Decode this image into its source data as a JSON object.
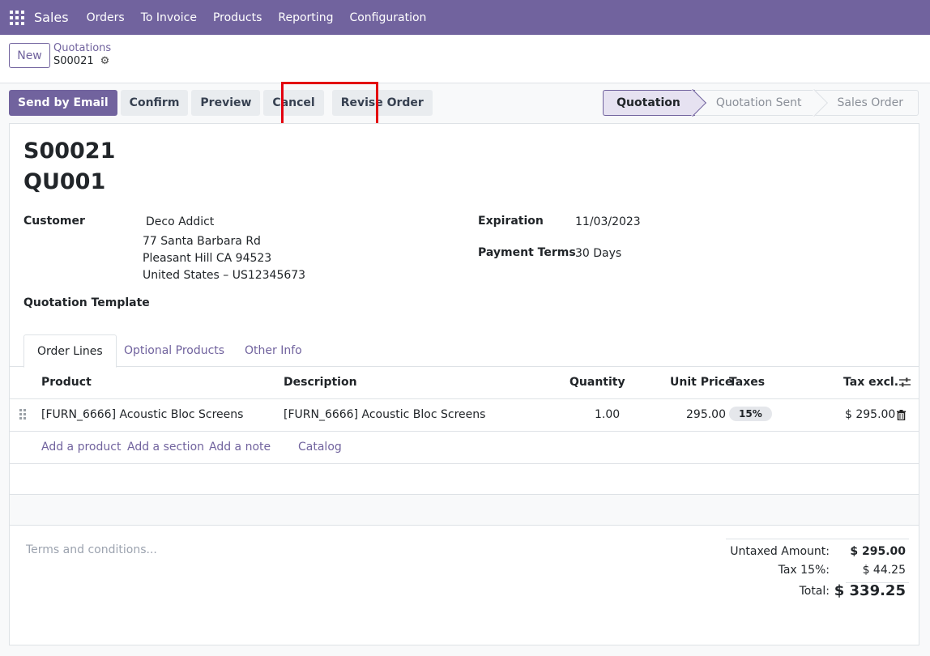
{
  "navbar": {
    "brand": "Sales",
    "menu": [
      "Orders",
      "To Invoice",
      "Products",
      "Reporting",
      "Configuration"
    ]
  },
  "control_panel": {
    "new_label": "New",
    "breadcrumb": "Quotations",
    "current_record": "S00021"
  },
  "actions": {
    "send_by_email": "Send by Email",
    "confirm": "Confirm",
    "preview": "Preview",
    "cancel": "Cancel",
    "revise_order": "Revise Order"
  },
  "statusbar": {
    "stages": [
      "Quotation",
      "Quotation Sent",
      "Sales Order"
    ],
    "active": "Quotation"
  },
  "form": {
    "title": "S00021",
    "subtitle": "QU001",
    "customer_label": "Customer",
    "customer_name": "Deco Addict",
    "address_line1": "77 Santa Barbara Rd",
    "address_line2": "Pleasant Hill CA 94523",
    "address_line3": "United States – US12345673",
    "expiration_label": "Expiration",
    "expiration_value": "11/03/2023",
    "payment_terms_label": "Payment Terms",
    "payment_terms_value": "30 Days",
    "quotation_template_label": "Quotation Template"
  },
  "tabs": [
    "Order Lines",
    "Optional Products",
    "Other Info"
  ],
  "table": {
    "headers": {
      "product": "Product",
      "description": "Description",
      "quantity": "Quantity",
      "unit_price": "Unit Price",
      "taxes": "Taxes",
      "tax_excl": "Tax excl."
    },
    "rows": [
      {
        "product": "[FURN_6666] Acoustic Bloc Screens",
        "description": "[FURN_6666] Acoustic Bloc Screens",
        "quantity": "1.00",
        "unit_price": "295.00",
        "tax": "15%",
        "subtotal": "$ 295.00"
      }
    ],
    "add_links": {
      "add_product": "Add a product",
      "add_section": "Add a section",
      "add_note": "Add a note",
      "catalog": "Catalog"
    }
  },
  "footer": {
    "terms_placeholder": "Terms and conditions...",
    "untaxed_label": "Untaxed Amount:",
    "untaxed_value": "$ 295.00",
    "tax_label": "Tax 15%:",
    "tax_value": "$ 44.25",
    "total_label": "Total:",
    "total_value": "$ 339.25"
  },
  "colors": {
    "brand": "#71639e",
    "highlight": "#e3000f"
  }
}
